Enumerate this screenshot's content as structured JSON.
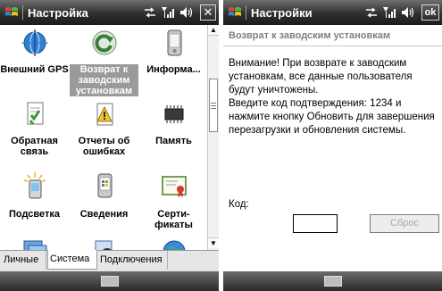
{
  "left_screen": {
    "title": "Настройка",
    "grid_items": [
      {
        "label": "Внешний GPS",
        "icon": "globe-gps-icon"
      },
      {
        "label": "Возврат к заводским установкам",
        "icon": "reset-arrow-icon",
        "selected": true
      },
      {
        "label": "Информа...",
        "icon": "device-info-icon"
      },
      {
        "label": "Обратная связь",
        "icon": "feedback-icon"
      },
      {
        "label": "Отчеты об ошибках",
        "icon": "error-report-icon"
      },
      {
        "label": "Память",
        "icon": "memory-chip-icon"
      },
      {
        "label": "Подсветка",
        "icon": "backlight-icon"
      },
      {
        "label": "Сведения",
        "icon": "about-device-icon"
      },
      {
        "label": "Серти-фикаты",
        "icon": "certificates-icon"
      }
    ],
    "tabs": [
      {
        "label": "Личные",
        "active": false
      },
      {
        "label": "Система",
        "active": true
      },
      {
        "label": "Подключения",
        "active": false
      }
    ],
    "close_label": "✕"
  },
  "right_screen": {
    "title": "Настройки",
    "ok_label": "ok",
    "subheader": "Возврат к заводским установкам",
    "warning_text": "Внимание! При возврате к заводским установкам, все данные пользователя будут уничтожены.",
    "instruction_text": "Введите код подтверждения: 1234 и нажмите кнопку Обновить для завершения перезагрузки и обновления системы.",
    "code_label": "Код:",
    "code_value": "",
    "reset_button": "Сброс"
  },
  "colors": {
    "titlebar": "#2f2f2f",
    "selected_label_bg": "#9a9a9a",
    "subheader_text": "#808080",
    "disabled_text": "#a8a8a8"
  }
}
